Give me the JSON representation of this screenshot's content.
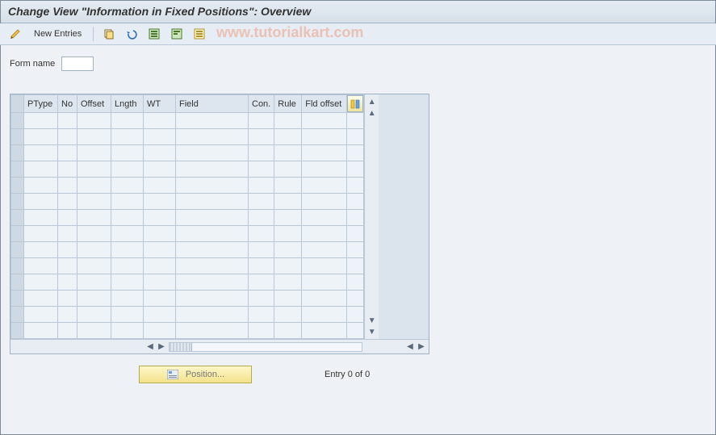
{
  "title": "Change View \"Information in Fixed Positions\": Overview",
  "toolbar": {
    "new_entries_label": "New Entries"
  },
  "watermark": "www.tutorialkart.com",
  "form": {
    "name_label": "Form name",
    "name_value": ""
  },
  "table": {
    "columns": [
      "PType",
      "No",
      "Offset",
      "Lngth",
      "WT",
      "Field",
      "Con.",
      "Rule",
      "Fld offset"
    ],
    "rows": [
      [
        "",
        "",
        "",
        "",
        "",
        "",
        "",
        "",
        ""
      ],
      [
        "",
        "",
        "",
        "",
        "",
        "",
        "",
        "",
        ""
      ],
      [
        "",
        "",
        "",
        "",
        "",
        "",
        "",
        "",
        ""
      ],
      [
        "",
        "",
        "",
        "",
        "",
        "",
        "",
        "",
        ""
      ],
      [
        "",
        "",
        "",
        "",
        "",
        "",
        "",
        "",
        ""
      ],
      [
        "",
        "",
        "",
        "",
        "",
        "",
        "",
        "",
        ""
      ],
      [
        "",
        "",
        "",
        "",
        "",
        "",
        "",
        "",
        ""
      ],
      [
        "",
        "",
        "",
        "",
        "",
        "",
        "",
        "",
        ""
      ],
      [
        "",
        "",
        "",
        "",
        "",
        "",
        "",
        "",
        ""
      ],
      [
        "",
        "",
        "",
        "",
        "",
        "",
        "",
        "",
        ""
      ],
      [
        "",
        "",
        "",
        "",
        "",
        "",
        "",
        "",
        ""
      ],
      [
        "",
        "",
        "",
        "",
        "",
        "",
        "",
        "",
        ""
      ],
      [
        "",
        "",
        "",
        "",
        "",
        "",
        "",
        "",
        ""
      ],
      [
        "",
        "",
        "",
        "",
        "",
        "",
        "",
        "",
        ""
      ]
    ]
  },
  "footer": {
    "position_label": "Position...",
    "entry_status": "Entry 0 of 0"
  }
}
